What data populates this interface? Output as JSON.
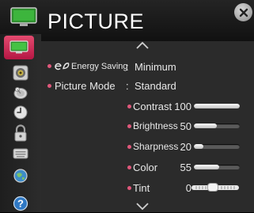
{
  "header": {
    "title": "PICTURE"
  },
  "sidebar": {
    "items": [
      {
        "name": "picture",
        "icon": "tv-icon",
        "selected": true
      },
      {
        "name": "audio",
        "icon": "speaker-icon"
      },
      {
        "name": "channel",
        "icon": "satellite-dish-icon"
      },
      {
        "name": "time",
        "icon": "clock-icon"
      },
      {
        "name": "lock",
        "icon": "padlock-icon"
      },
      {
        "name": "option",
        "icon": "keyboard-icon"
      },
      {
        "name": "network",
        "icon": "globe-icon"
      },
      {
        "name": "support",
        "icon": "help-icon"
      }
    ]
  },
  "settings": {
    "energy_saving": {
      "label": "Energy Saving",
      "value": "Minimum"
    },
    "picture_mode": {
      "label": "Picture Mode",
      "value": "Standard"
    },
    "separator": ":"
  },
  "adjustments": [
    {
      "label": "Contrast",
      "value": "100",
      "level": 100
    },
    {
      "label": "Brightness",
      "value": "50",
      "level": 50
    },
    {
      "label": "Sharpness",
      "value": "20",
      "level": 20
    },
    {
      "label": "Color",
      "value": "55",
      "level": 55
    },
    {
      "label": "Tint",
      "value": "0",
      "level": 0
    }
  ],
  "colors": {
    "accent": "#d6335c",
    "panel": "#2b2b2b",
    "bullet": "#e0587b"
  }
}
